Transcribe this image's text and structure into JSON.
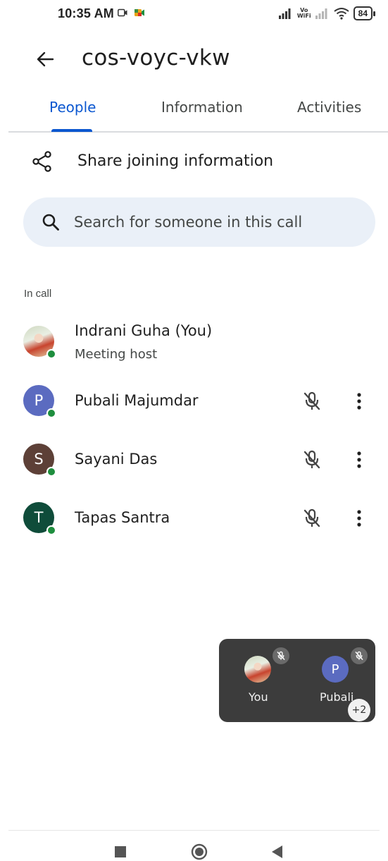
{
  "status_bar": {
    "time": "10:35 AM",
    "vo_top": "Vo",
    "vo_bottom": "WiFi",
    "battery": "84"
  },
  "header": {
    "title": "cos-voyc-vkw"
  },
  "tabs": [
    {
      "label": "People",
      "active": true
    },
    {
      "label": "Information",
      "active": false
    },
    {
      "label": "Activities",
      "active": false
    }
  ],
  "share": {
    "label": "Share joining information",
    "icon": "share-icon"
  },
  "search": {
    "placeholder": "Search for someone in this call",
    "icon": "search-icon"
  },
  "section_label": "In call",
  "participants": [
    {
      "name": "Indrani Guha (You)",
      "subtitle": "Meeting host",
      "avatar": "photo",
      "online": true
    },
    {
      "name": "Pubali Majumdar",
      "initial": "P",
      "avatar_color": "#5b6bc0",
      "muted": true,
      "online": true
    },
    {
      "name": "Sayani Das",
      "initial": "S",
      "avatar_color": "#5d4037",
      "muted": true,
      "online": true
    },
    {
      "name": "Tapas Santra",
      "initial": "T",
      "avatar_color": "#0f4c3a",
      "muted": true,
      "online": true
    }
  ],
  "floating_tile": {
    "tiles": [
      {
        "name": "You",
        "avatar": "photo",
        "muted": true
      },
      {
        "name": "Pubali",
        "initial": "P",
        "avatar_color": "#5b6bc0",
        "muted": true
      }
    ],
    "more_count": "+2"
  },
  "nav": [
    "recent-apps-icon",
    "home-icon",
    "back-icon"
  ],
  "colors": {
    "accent": "#0b57d0",
    "search_bg": "#eaf0f8",
    "online": "#1e8e3e",
    "tile_bg": "#3c3c3c"
  }
}
